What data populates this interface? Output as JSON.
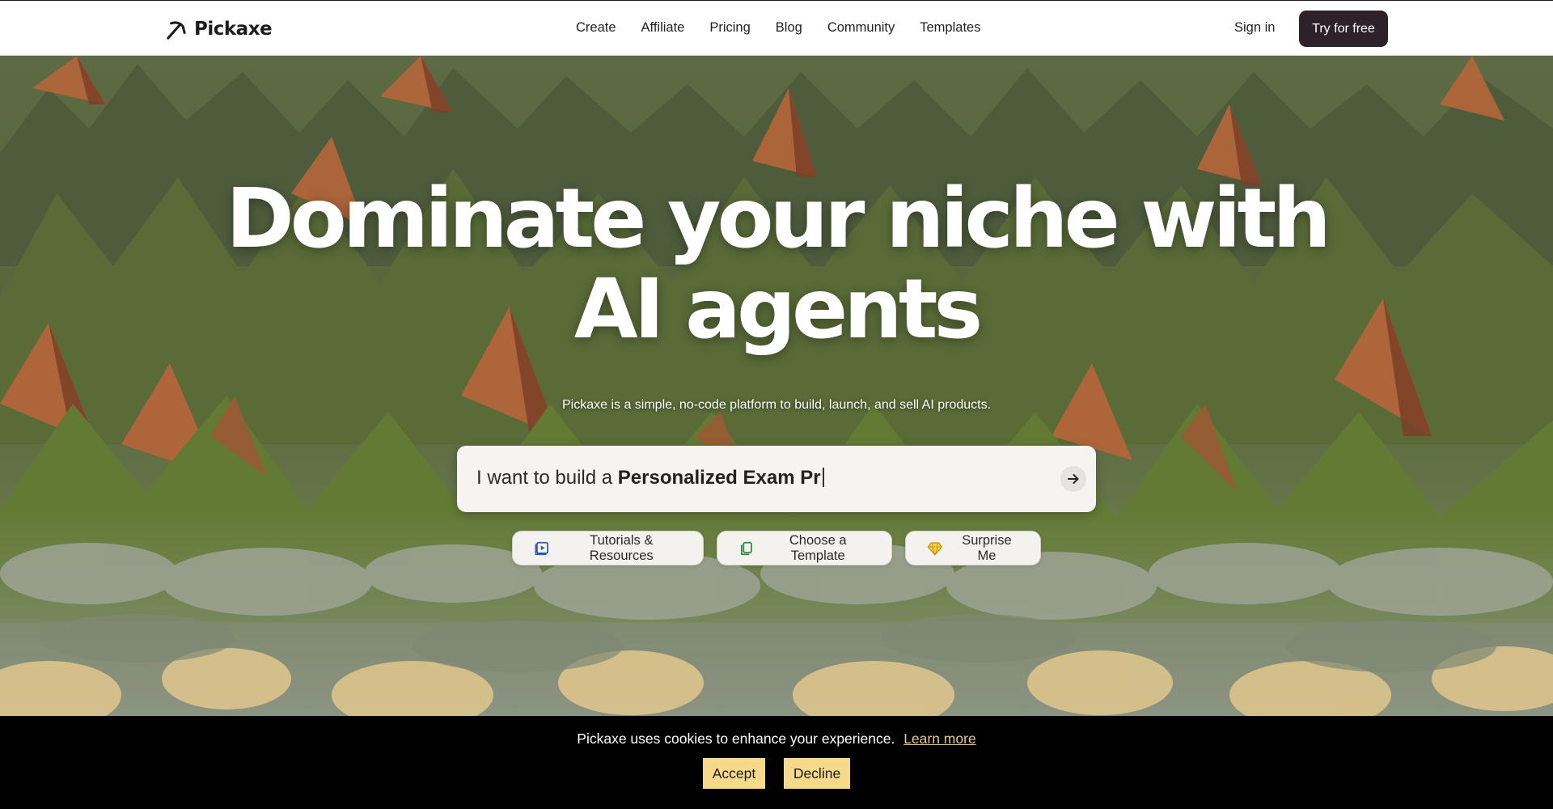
{
  "header": {
    "brand": "Pickaxe",
    "nav": [
      "Create",
      "Affiliate",
      "Pricing",
      "Blog",
      "Community",
      "Templates"
    ],
    "sign_in": "Sign in",
    "cta": "Try for free",
    "logo_icon": "pickaxe-arrow-icon"
  },
  "hero": {
    "headline_line1": "Dominate your niche with",
    "headline_line2": "AI agents",
    "subtitle": "Pickaxe is a simple, no-code platform to build, launch, and sell AI products.",
    "prompt_prefix": "I want to build a ",
    "prompt_typed": "Personalized Exam Pr",
    "submit_icon": "arrow-right-icon",
    "pills": [
      {
        "label": "Tutorials & Resources",
        "icon": "play-video-icon",
        "color": "#2f5aa8"
      },
      {
        "label": "Choose a Template",
        "icon": "copy-icon",
        "color": "#2e8b3e"
      },
      {
        "label": "Surprise Me",
        "icon": "diamond-icon",
        "color": "#d9a81b"
      }
    ]
  },
  "cookie": {
    "message": "Pickaxe uses cookies to enhance your experience.",
    "learn_more": "Learn more",
    "accept": "Accept",
    "decline": "Decline"
  },
  "colors": {
    "cta_bg": "#2d2229",
    "cookie_bg": "#000000",
    "cookie_button_bg": "#f6d98a",
    "link_accent": "#e8c98a"
  }
}
